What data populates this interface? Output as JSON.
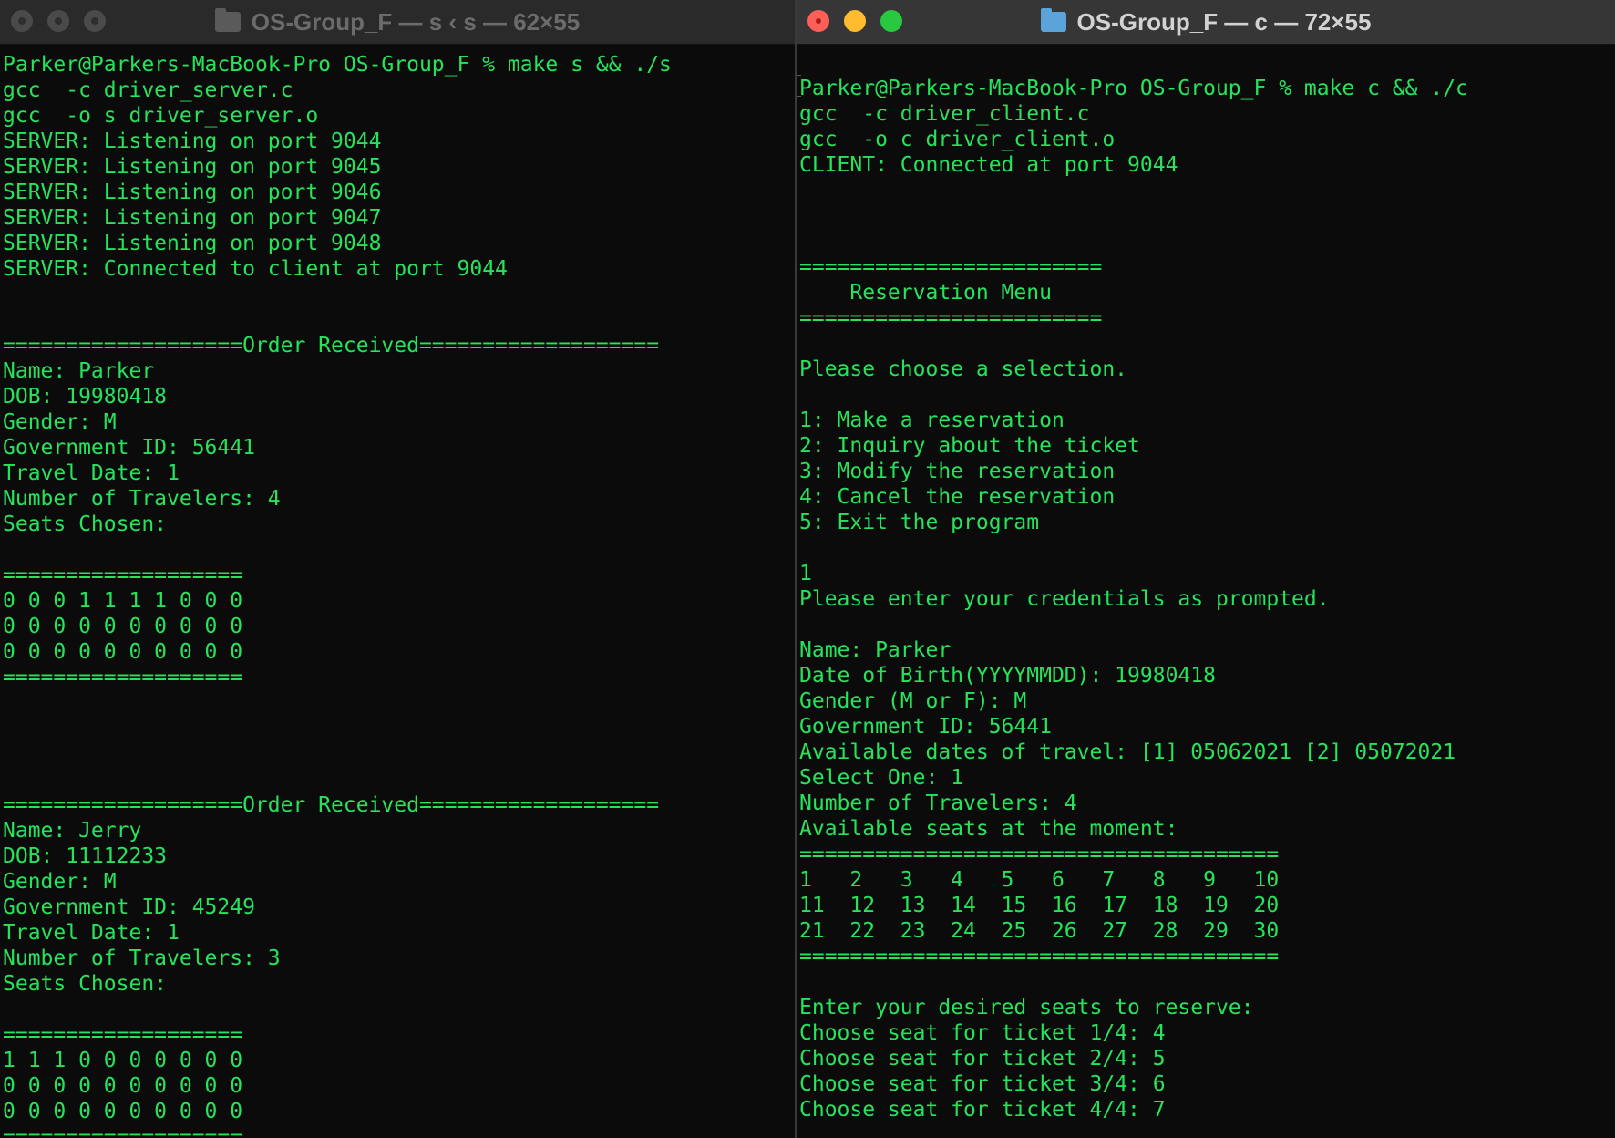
{
  "left_window": {
    "title": "OS-Group_F — s ‹ s — 62×55",
    "lines": [
      "Parker@Parkers-MacBook-Pro OS-Group_F % make s && ./s",
      "gcc  -c driver_server.c",
      "gcc  -o s driver_server.o",
      "SERVER: Listening on port 9044",
      "SERVER: Listening on port 9045",
      "SERVER: Listening on port 9046",
      "SERVER: Listening on port 9047",
      "SERVER: Listening on port 9048",
      "SERVER: Connected to client at port 9044",
      "",
      "",
      "===================Order Received===================",
      "Name: Parker",
      "DOB: 19980418",
      "Gender: M",
      "Government ID: 56441",
      "Travel Date: 1",
      "Number of Travelers: 4",
      "Seats Chosen:",
      "",
      "===================",
      "0 0 0 1 1 1 1 0 0 0",
      "0 0 0 0 0 0 0 0 0 0",
      "0 0 0 0 0 0 0 0 0 0",
      "===================",
      "",
      "",
      "",
      "",
      "===================Order Received===================",
      "Name: Jerry",
      "DOB: 11112233",
      "Gender: M",
      "Government ID: 45249",
      "Travel Date: 1",
      "Number of Travelers: 3",
      "Seats Chosen:",
      "",
      "===================",
      "1 1 1 0 0 0 0 0 0 0",
      "0 0 0 0 0 0 0 0 0 0",
      "0 0 0 0 0 0 0 0 0 0",
      "==================="
    ]
  },
  "right_window": {
    "title": "OS-Group_F — c — 72×55",
    "lines": [
      "Parker@Parkers-MacBook-Pro OS-Group_F % make c && ./c",
      "gcc  -c driver_client.c",
      "gcc  -o c driver_client.o",
      "CLIENT: Connected at port 9044",
      "",
      "",
      "",
      "========================",
      "    Reservation Menu",
      "========================",
      "",
      "Please choose a selection.",
      "",
      "1: Make a reservation",
      "2: Inquiry about the ticket",
      "3: Modify the reservation",
      "4: Cancel the reservation",
      "5: Exit the program",
      "",
      "1",
      "Please enter your credentials as prompted.",
      "",
      "Name: Parker",
      "Date of Birth(YYYYMMDD): 19980418",
      "Gender (M or F): M",
      "Government ID: 56441",
      "Available dates of travel: [1] 05062021 [2] 05072021",
      "Select One: 1",
      "Number of Travelers: 4",
      "Available seats at the moment:",
      "======================================",
      "1   2   3   4   5   6   7   8   9   10",
      "11  12  13  14  15  16  17  18  19  20",
      "21  22  23  24  25  26  27  28  29  30",
      "======================================",
      "",
      "Enter your desired seats to reserve:",
      "Choose seat for ticket 1/4: 4",
      "Choose seat for ticket 2/4: 5",
      "Choose seat for ticket 3/4: 6",
      "Choose seat for ticket 4/4: 7"
    ]
  },
  "colors": {
    "terminal_text": "#26e35b",
    "terminal_bg": "#0b0b0b"
  }
}
